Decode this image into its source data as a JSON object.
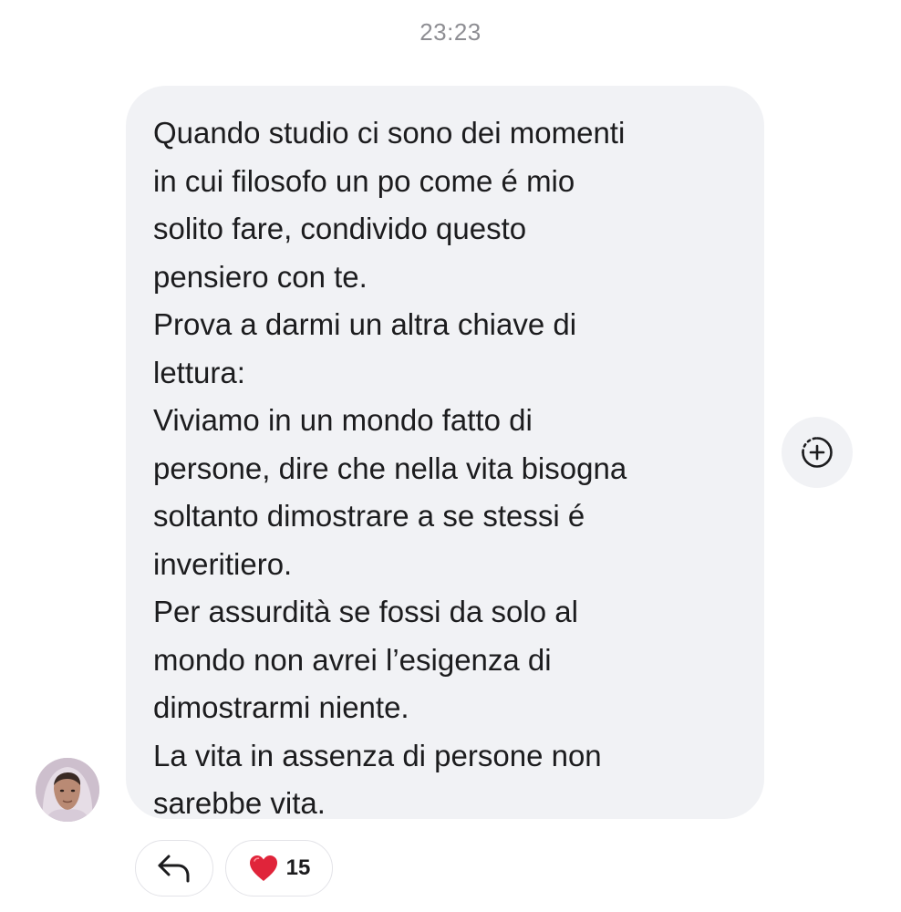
{
  "timestamp": "23:23",
  "message": {
    "paragraphs": [
      [
        "Quando studio ci sono dei momenti",
        "in cui filosofo un po come é mio",
        "solito fare, condivido questo",
        "pensiero con te."
      ],
      [
        "Prova a darmi un altra chiave di",
        "lettura:"
      ],
      [
        "Viviamo in un mondo fatto di",
        "persone, dire che nella vita bisogna",
        "soltanto dimostrare a se stessi é",
        "inveritiero."
      ],
      [
        "Per assurdità se fossi da solo al",
        "mondo non avrei l’esigenza di",
        "dimostrarmi niente."
      ],
      [
        "La vita in assenza di persone non",
        "sarebbe vita."
      ]
    ]
  },
  "reactions": {
    "heart_count": "15"
  },
  "icons": {
    "add_reaction": "add-reaction-icon",
    "reply": "reply-arrow-icon",
    "heart": "heart-icon",
    "avatar": "user-avatar"
  },
  "colors": {
    "bubble_bg": "#f1f2f5",
    "timestamp": "#8e8e93",
    "heart": "#e0243a"
  }
}
